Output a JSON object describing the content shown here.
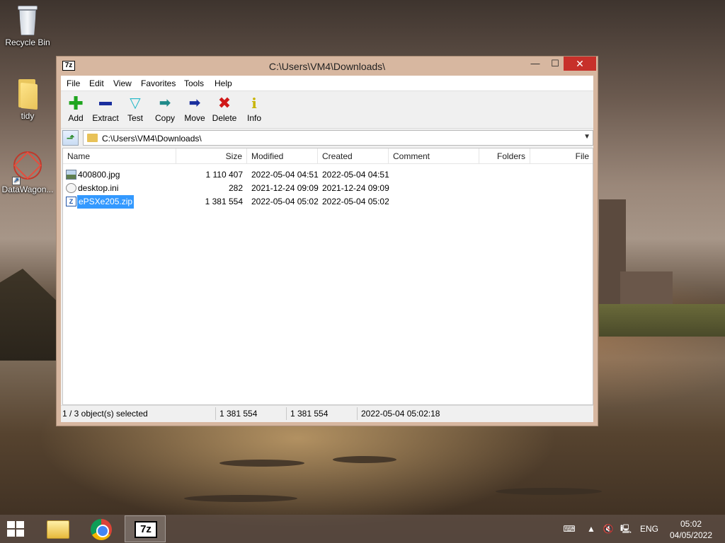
{
  "desktop": {
    "icons": [
      {
        "label": "Recycle Bin"
      },
      {
        "label": "tidy"
      },
      {
        "label": "DataWagon..."
      }
    ]
  },
  "window": {
    "title": "C:\\Users\\VM4\\Downloads\\",
    "app_logo": "7z",
    "controls": {
      "minimize": "—",
      "maximize": "☐",
      "close": "✕"
    }
  },
  "menu": [
    "File",
    "Edit",
    "View",
    "Favorites",
    "Tools",
    "Help"
  ],
  "toolbar": [
    {
      "label": "Add",
      "icon": "plus-icon",
      "color": "#1fa51f"
    },
    {
      "label": "Extract",
      "icon": "minus-icon",
      "color": "#1a2f9e"
    },
    {
      "label": "Test",
      "icon": "check-icon",
      "color": "#22b8c8"
    },
    {
      "label": "Copy",
      "icon": "copy-arrow-icon",
      "color": "#1f8a8a"
    },
    {
      "label": "Move",
      "icon": "move-arrow-icon",
      "color": "#1a2f9e"
    },
    {
      "label": "Delete",
      "icon": "delete-x-icon",
      "color": "#d01818"
    },
    {
      "label": "Info",
      "icon": "info-icon",
      "color": "#c8b400"
    }
  ],
  "address": {
    "path": "C:\\Users\\VM4\\Downloads\\"
  },
  "columns": [
    "Name",
    "Size",
    "Modified",
    "Created",
    "Comment",
    "Folders",
    "File"
  ],
  "files": [
    {
      "name": "400800.jpg",
      "size": "1 110 407",
      "modified": "2022-05-04 04:51",
      "created": "2022-05-04 04:51",
      "type": "img",
      "selected": false
    },
    {
      "name": "desktop.ini",
      "size": "282",
      "modified": "2021-12-24 09:09",
      "created": "2021-12-24 09:09",
      "type": "ini",
      "selected": false
    },
    {
      "name": "ePSXe205.zip",
      "size": "1 381 554",
      "modified": "2022-05-04 05:02",
      "created": "2022-05-04 05:02",
      "type": "zip",
      "selected": true
    }
  ],
  "status": {
    "selection": "1 / 3 object(s) selected",
    "size": "1 381 554",
    "packed": "1 381 554",
    "modified": "2022-05-04 05:02:18"
  },
  "taskbar": {
    "lang": "ENG",
    "time": "05:02",
    "date": "04/05/2022",
    "active_app": "7z"
  }
}
